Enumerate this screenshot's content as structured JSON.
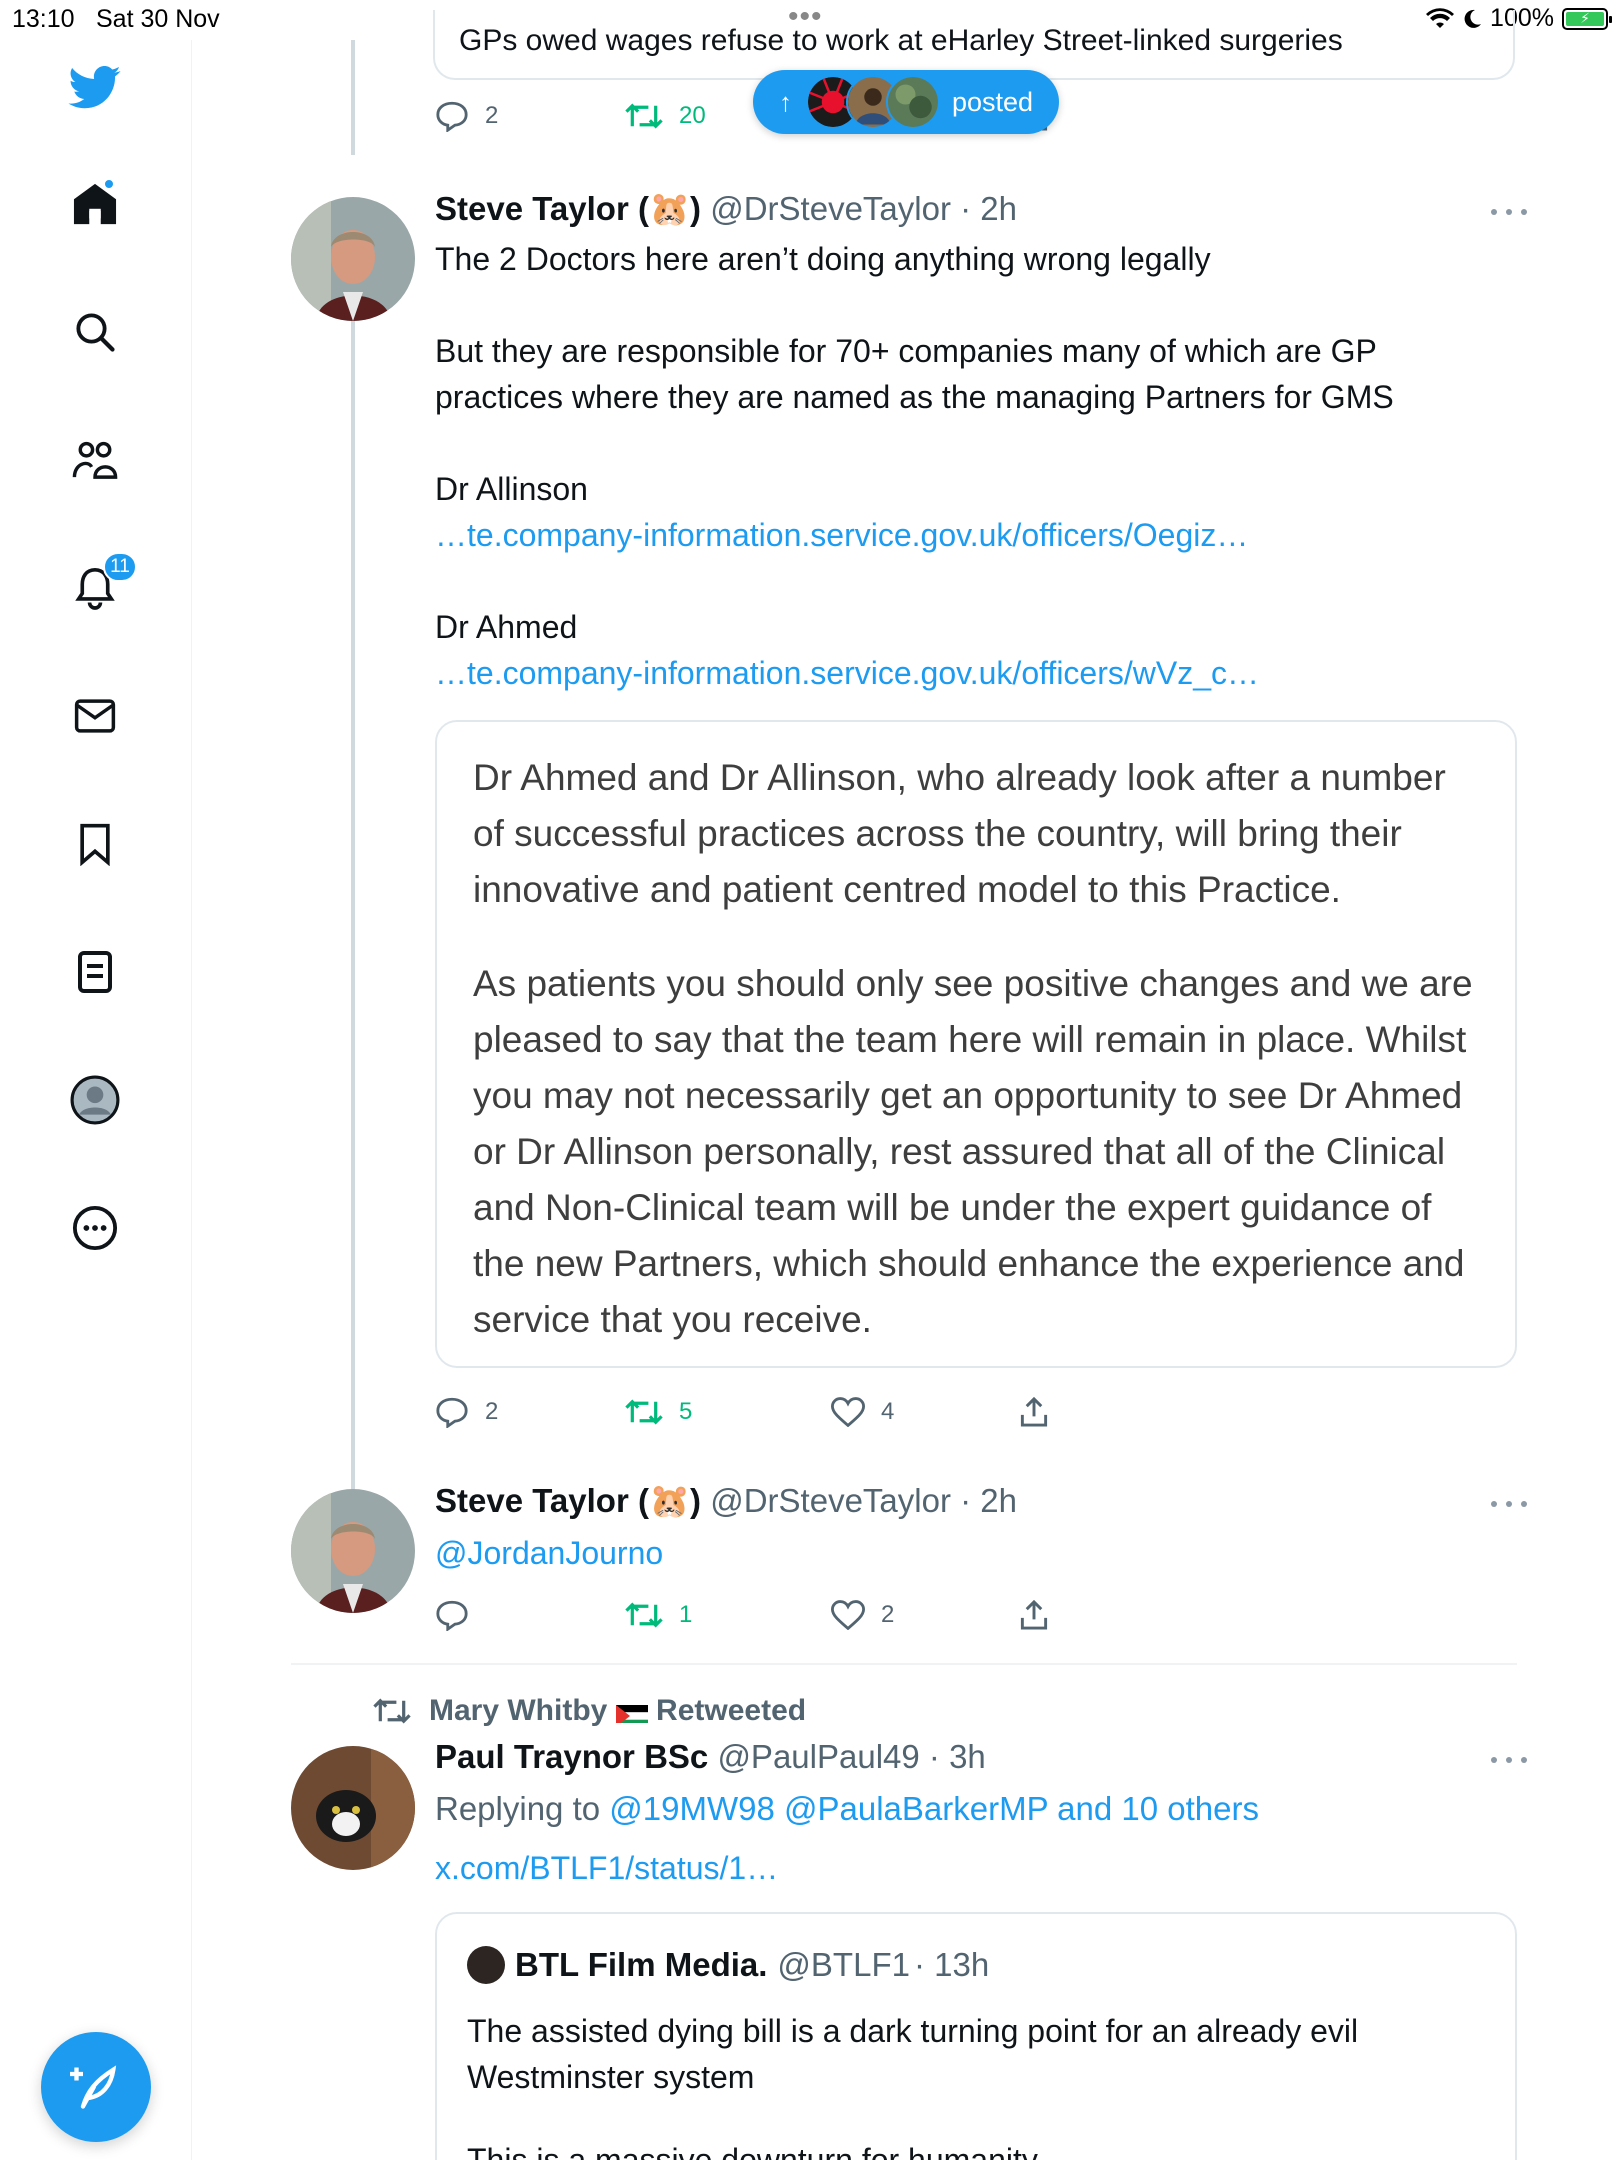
{
  "status_bar": {
    "time": "13:10",
    "date": "Sat 30 Nov",
    "battery": "100%"
  },
  "sidebar": {
    "notifications_badge": "11"
  },
  "top_card": {
    "quote_title": "GPs owed wages refuse to work at eHarley Street-linked surgeries",
    "replies": "2",
    "retweets": "20"
  },
  "new_posts_pill": {
    "label": "posted"
  },
  "tweets": [
    {
      "name": "Steve Taylor (🐹)",
      "handle": "@DrSteveTaylor",
      "time": "· 2h",
      "line1": "The 2 Doctors here aren’t doing anything wrong legally",
      "line2": "But they are responsible for 70+ companies many of which are GP practices where they are named as the managing Partners for GMS",
      "label_a": "Dr Allinson",
      "link_a": "…te.company-information.service.gov.uk/officers/Oegiz…",
      "label_b": "Dr Ahmed",
      "link_b": "…te.company-information.service.gov.uk/officers/wVz_c…",
      "image_para1": "Dr Ahmed and Dr Allinson, who already look after a number of successful practices across the country, will bring their innovative and patient centred model to this Practice.",
      "image_para2": "As patients you should only see positive changes and we are pleased to say that the team here will remain in place. Whilst you may not necessarily get an opportunity to see Dr Ahmed or Dr Allinson personally, rest assured that all of the Clinical and Non-Clinical team will be under the expert guidance of the new Partners, which should enhance the experience and service that you receive.",
      "replies": "2",
      "retweets": "5",
      "likes": "4"
    },
    {
      "name": "Steve Taylor (🐹)",
      "handle": "@DrSteveTaylor",
      "time": "· 2h",
      "mention": "@JordanJourno",
      "retweets": "1",
      "likes": "2"
    },
    {
      "retweeted_by": "Mary Whitby",
      "retweeted_label": "Retweeted",
      "name": "Paul Traynor BSc",
      "handle": "@PaulPaul49",
      "time": "· 3h",
      "replying_prefix": "Replying to",
      "replying_to": "@19MW98 @PaulaBarkerMP and 10 others",
      "link": "x.com/BTLF1/status/1…",
      "quoted": {
        "name": "BTL Film Media.",
        "handle": "@BTLF1",
        "time": "· 13h",
        "text": "The assisted dying bill is a dark turning point for an already evil Westminster system",
        "text2": "This is a massive downturn for humanity"
      }
    }
  ]
}
